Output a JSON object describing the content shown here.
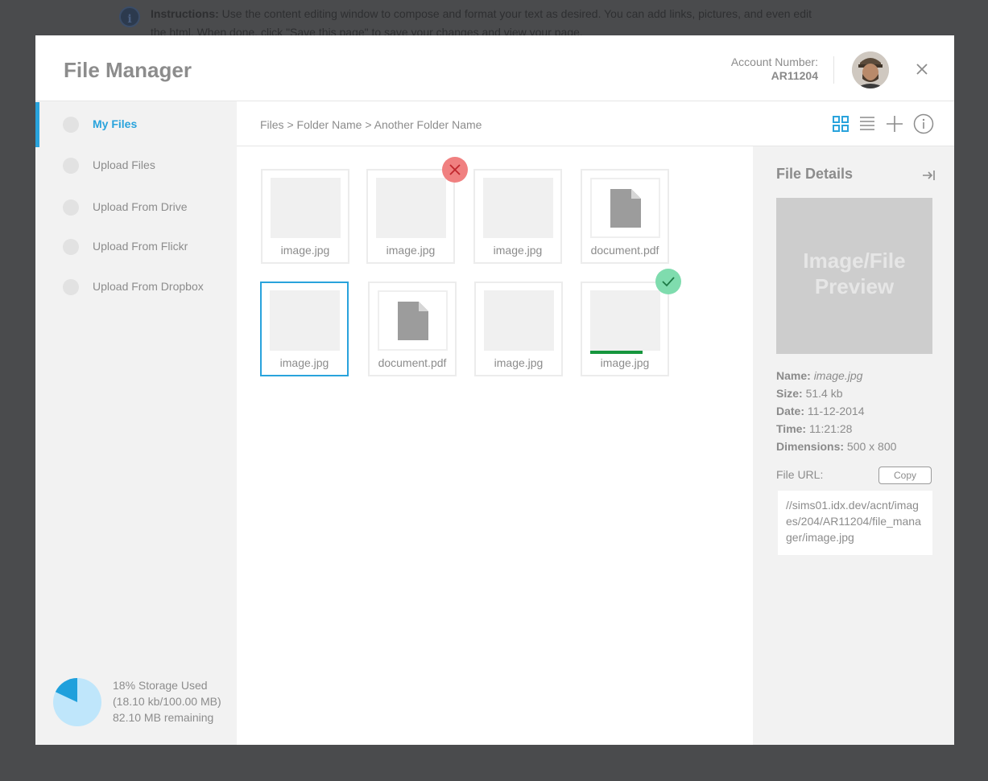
{
  "background": {
    "instructions_bold": "Instructions:",
    "instructions_text": "Use the content editing window to compose and format your text as desired. You can add links, pictures, and even edit the html. When done, click \"Save this page\" to save your changes and view your page."
  },
  "header": {
    "title": "File Manager",
    "account_label": "Account Number:",
    "account_number": "AR11204"
  },
  "sidebar": {
    "items": [
      {
        "label": "My Files",
        "active": true
      },
      {
        "label": "Upload Files"
      },
      {
        "label": "Upload From Drive"
      },
      {
        "label": "Upload From Flickr"
      },
      {
        "label": "Upload From Dropbox"
      }
    ],
    "storage": {
      "used_fraction": 0.18,
      "line1": "18% Storage Used",
      "line2": "(18.10 kb/100.00 MB)",
      "line3": "82.10 MB remaining"
    }
  },
  "toolbar": {
    "breadcrumb": "Files > Folder Name > Another Folder Name"
  },
  "files": [
    {
      "name": "image.jpg",
      "type": "image"
    },
    {
      "name": "image.jpg",
      "type": "image",
      "badge": "remove"
    },
    {
      "name": "image.jpg",
      "type": "image"
    },
    {
      "name": "document.pdf",
      "type": "document"
    },
    {
      "name": "image.jpg",
      "type": "image",
      "selected": true
    },
    {
      "name": "document.pdf",
      "type": "document"
    },
    {
      "name": "image.jpg",
      "type": "image"
    },
    {
      "name": "image.jpg",
      "type": "image",
      "badge": "done",
      "progress": 0.75
    }
  ],
  "details": {
    "title": "File Details",
    "preview_line1": "Image/File",
    "preview_line2": "Preview",
    "name_label": "Name:",
    "name_value": "image.jpg",
    "size_label": "Size:",
    "size_value": "51.4 kb",
    "date_label": "Date:",
    "date_value": "11-12-2014",
    "time_label": "Time:",
    "time_value": "11:21:28",
    "dimensions_label": "Dimensions:",
    "dimensions_value": "500 x 800",
    "url_label": "File URL:",
    "copy_label": "Copy",
    "url_value": "//sims01.idx.dev/acnt/images/204/AR11204/file_manager/image.jpg"
  },
  "colors": {
    "accent": "#29a3dc",
    "remove_badge": "#f08080",
    "done_badge": "#7fdcae",
    "progress": "#16963d",
    "storage_used": "#1fa0dc",
    "storage_free": "#bfe6fb"
  }
}
